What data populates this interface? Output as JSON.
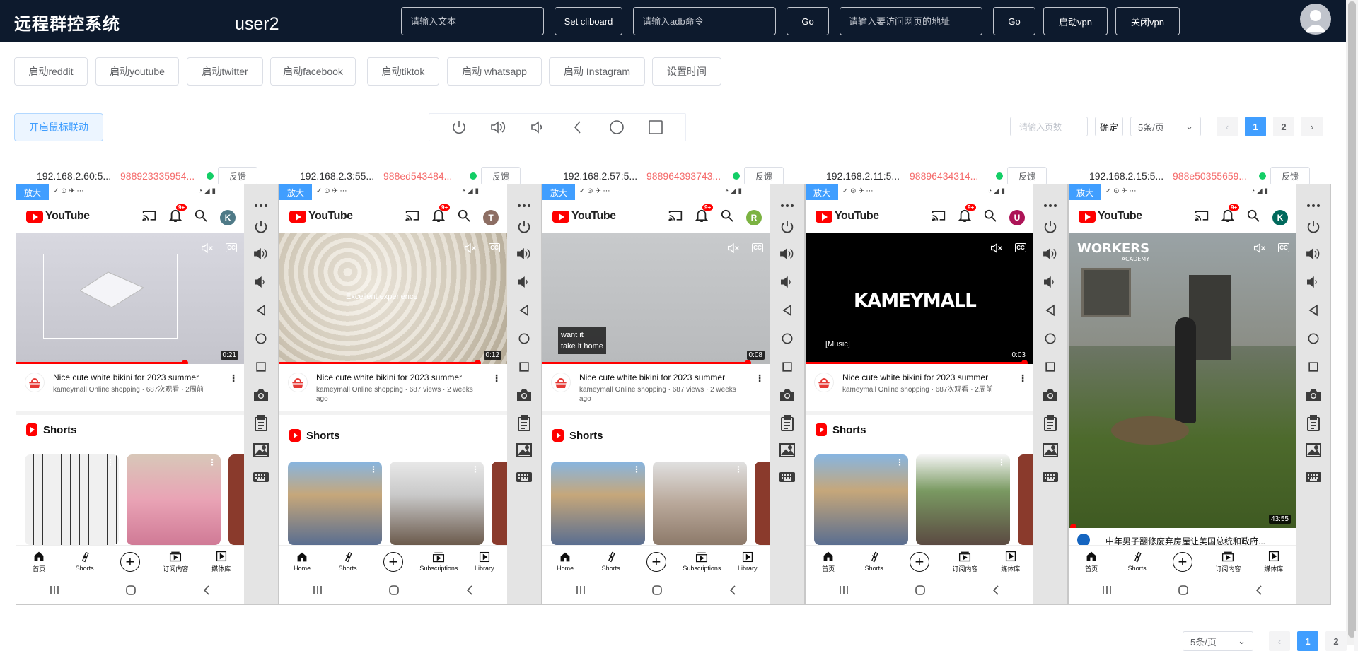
{
  "header": {
    "title": "远程群控系统",
    "user": "user2",
    "text_placeholder": "请输入文本",
    "set_clipboard": "Set cliboard",
    "adb_placeholder": "请输入adb命令",
    "go1": "Go",
    "url_placeholder": "请输入要访问网页的地址",
    "go2": "Go",
    "vpn_on": "启动vpn",
    "vpn_off": "关闭vpn"
  },
  "apps": [
    "启动reddit",
    "启动youtube",
    "启动twitter",
    "启动facebook",
    "启动tiktok",
    "启动 whatsapp",
    "启动 Instagram",
    "设置时间"
  ],
  "mouse_link": "开启鼠标联动",
  "pager": {
    "page_placeholder": "请输入页数",
    "confirm": "确定",
    "page_size": "5条/页",
    "pages": [
      "1",
      "2"
    ],
    "active": "1"
  },
  "feedback": "反馈",
  "zoom": "放大",
  "devices": [
    {
      "ip": "192.168.2.60:5...",
      "id": "988923335954...",
      "account": "K",
      "account_color": "#4f7a87",
      "title": "Nice cute white bikini for 2023 summer",
      "sub": "kameymall Online shopping · 687次观看 · 2周前",
      "duration": "0:21",
      "progress": 74,
      "caption": "",
      "nav": [
        "首页",
        "Shorts",
        "",
        "订阅内容",
        "媒体库"
      ],
      "shorts_label": "Shorts"
    },
    {
      "ip": "192.168.2.3:55...",
      "id": "988ed543484...",
      "account": "T",
      "account_color": "#8d6e63",
      "title": "Nice cute white bikini for 2023 summer",
      "sub": "kameymall Online shopping · 687 views · 2 weeks ago",
      "duration": "0:12",
      "progress": 87,
      "caption": "Excellent experience",
      "nav": [
        "Home",
        "Shorts",
        "",
        "Subscriptions",
        "Library"
      ],
      "shorts_label": "Shorts"
    },
    {
      "ip": "192.168.2.57:5...",
      "id": "988964393743...",
      "account": "R",
      "account_color": "#7cb342",
      "title": "Nice cute white bikini for 2023 summer",
      "sub": "kameymall Online shopping · 687 views · 2 weeks ago",
      "duration": "0:08",
      "progress": 90,
      "caption": "want it\ntake it home",
      "nav": [
        "Home",
        "Shorts",
        "",
        "Subscriptions",
        "Library"
      ],
      "shorts_label": "Shorts"
    },
    {
      "ip": "192.168.2.11:5...",
      "id": "98896434314...",
      "account": "U",
      "account_color": "#ad1457",
      "title": "Nice cute white bikini for 2023 summer",
      "sub": "kameymall Online shopping · 687次观看 · 2周前",
      "duration": "0:03",
      "progress": 96,
      "caption": "[Music]",
      "brand": "KAMEYMALL",
      "nav": [
        "首页",
        "Shorts",
        "",
        "订阅内容",
        "媒体库"
      ],
      "shorts_label": "Shorts"
    },
    {
      "ip": "192.168.2.15:5...",
      "id": "988e50355659...",
      "account": "K",
      "account_color": "#00695c",
      "duration": "43:55",
      "watermark": "WORKERS",
      "watermark_sub": "ACADEMY",
      "title": "中年男子翻修废弃房屋让美国总统和政府...",
      "nav": [
        "首页",
        "Shorts",
        "",
        "订阅内容",
        "媒体库"
      ]
    }
  ],
  "colors": {
    "header_bg": "#0d1a2d",
    "accent": "#409eff",
    "danger": "#f56c6c",
    "online": "#13ce66"
  }
}
